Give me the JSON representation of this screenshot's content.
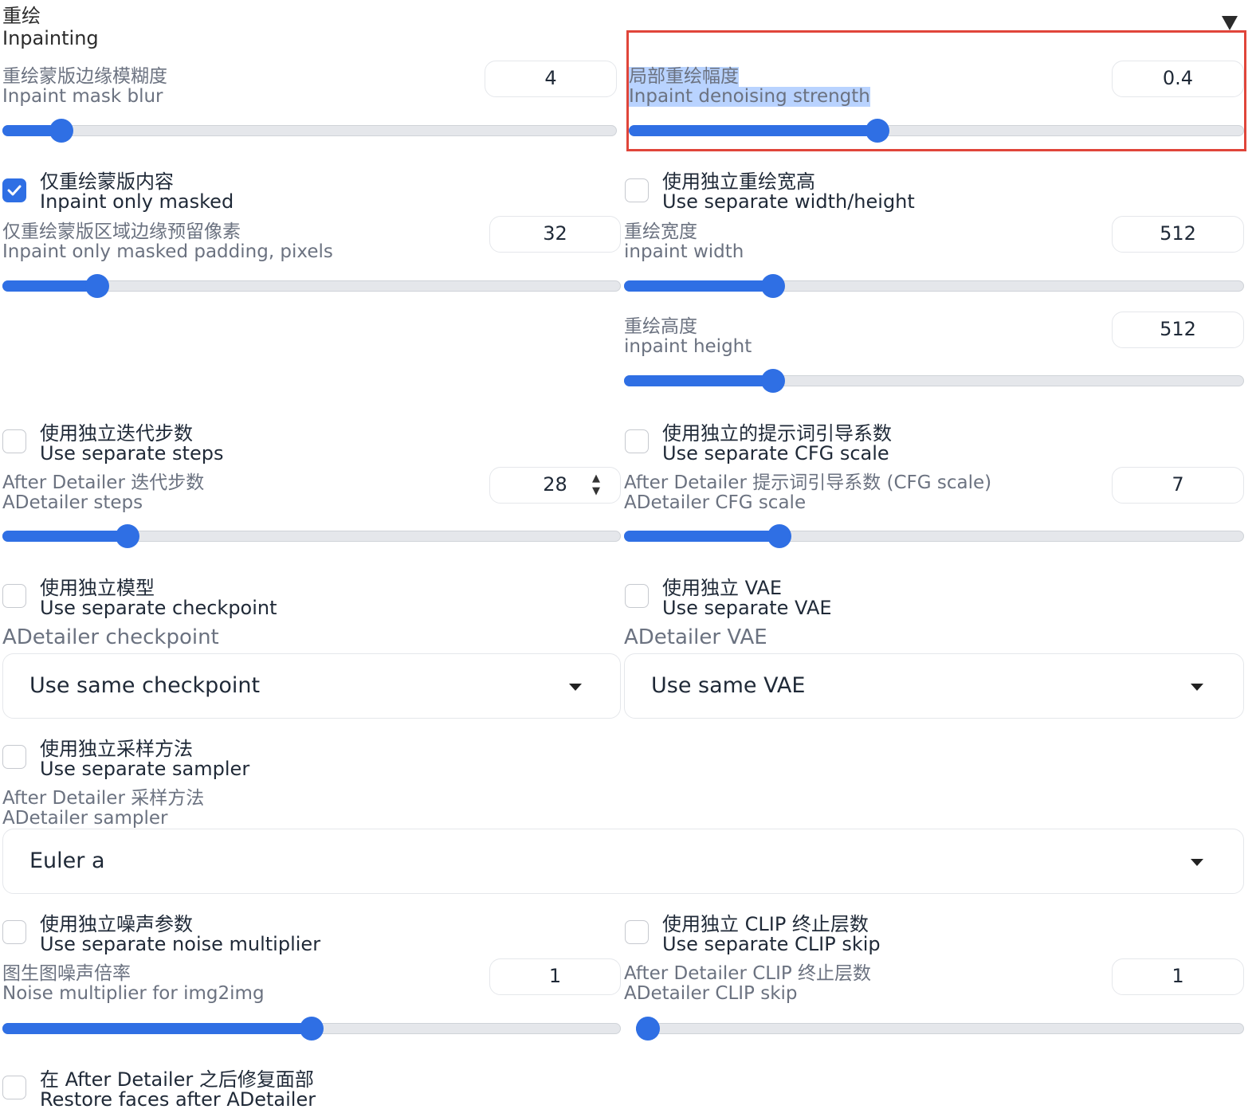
{
  "section": {
    "title_zh": "重绘",
    "title_en": "Inpainting",
    "collapse_icon": "triangle-down-icon"
  },
  "mask_blur": {
    "label_zh": "重绘蒙版边缘模糊度",
    "label_en": "Inpaint mask blur",
    "value": "4",
    "fill_fraction": 0.08
  },
  "denoise": {
    "label_zh": "局部重绘幅度",
    "label_en": "Inpaint denoising strength",
    "value": "0.4",
    "fill_fraction": 0.4
  },
  "only_masked": {
    "label_zh": "仅重绘蒙版内容",
    "label_en": "Inpaint only masked",
    "checked": true
  },
  "separate_wh": {
    "label_zh": "使用独立重绘宽高",
    "label_en": "Use separate width/height",
    "checked": false
  },
  "padding": {
    "label_zh": "仅重绘蒙版区域边缘预留像素",
    "label_en": "Inpaint only masked padding, pixels",
    "value": "32",
    "fill_fraction": 0.14
  },
  "inpaint_width": {
    "label_zh": "重绘宽度",
    "label_en": "inpaint width",
    "value": "512",
    "fill_fraction": 0.23
  },
  "inpaint_height": {
    "label_zh": "重绘高度",
    "label_en": "inpaint height",
    "value": "512",
    "fill_fraction": 0.23
  },
  "separate_steps": {
    "label_zh": "使用独立迭代步数",
    "label_en": "Use separate steps",
    "checked": false
  },
  "separate_cfg": {
    "label_zh": "使用独立的提示词引导系数",
    "label_en": "Use separate CFG scale",
    "checked": false
  },
  "steps": {
    "label_zh": "After Detailer 迭代步数",
    "label_en": "ADetailer steps",
    "value": "28",
    "fill_fraction": 0.19
  },
  "cfg": {
    "label_zh": "After Detailer 提示词引导系数 (CFG scale)",
    "label_en": "ADetailer CFG scale",
    "value": "7",
    "fill_fraction": 0.24
  },
  "separate_checkpoint": {
    "label_zh": "使用独立模型",
    "label_en": "Use separate checkpoint",
    "checked": false
  },
  "separate_vae": {
    "label_zh": "使用独立 VAE",
    "label_en": "Use separate VAE",
    "checked": false
  },
  "checkpoint": {
    "label": "ADetailer checkpoint",
    "value": "Use same checkpoint"
  },
  "vae": {
    "label": "ADetailer VAE",
    "value": "Use same VAE"
  },
  "separate_sampler": {
    "label_zh": "使用独立采样方法",
    "label_en": "Use separate sampler",
    "checked": false
  },
  "sampler": {
    "label_zh": "After Detailer 采样方法",
    "label_en": "ADetailer sampler",
    "value": "Euler a"
  },
  "separate_noise": {
    "label_zh": "使用独立噪声参数",
    "label_en": "Use separate noise multiplier",
    "checked": false
  },
  "separate_clip": {
    "label_zh": "使用独立 CLIP 终止层数",
    "label_en": "Use separate CLIP skip",
    "checked": false
  },
  "noise": {
    "label_zh": "图生图噪声倍率",
    "label_en": "Noise multiplier for img2img",
    "value": "1",
    "fill_fraction": 0.5
  },
  "clip": {
    "label_zh": "After Detailer CLIP 终止层数",
    "label_en": "ADetailer CLIP skip",
    "value": "1",
    "fill_fraction": 0.0
  },
  "restore_faces": {
    "label_zh": "在 After Detailer 之后修复面部",
    "label_en": "Restore faces after ADetailer",
    "checked": false
  },
  "colors": {
    "accent": "#2f6fe4",
    "highlight_border": "#e0453a",
    "selection": "#b9d3ff"
  }
}
